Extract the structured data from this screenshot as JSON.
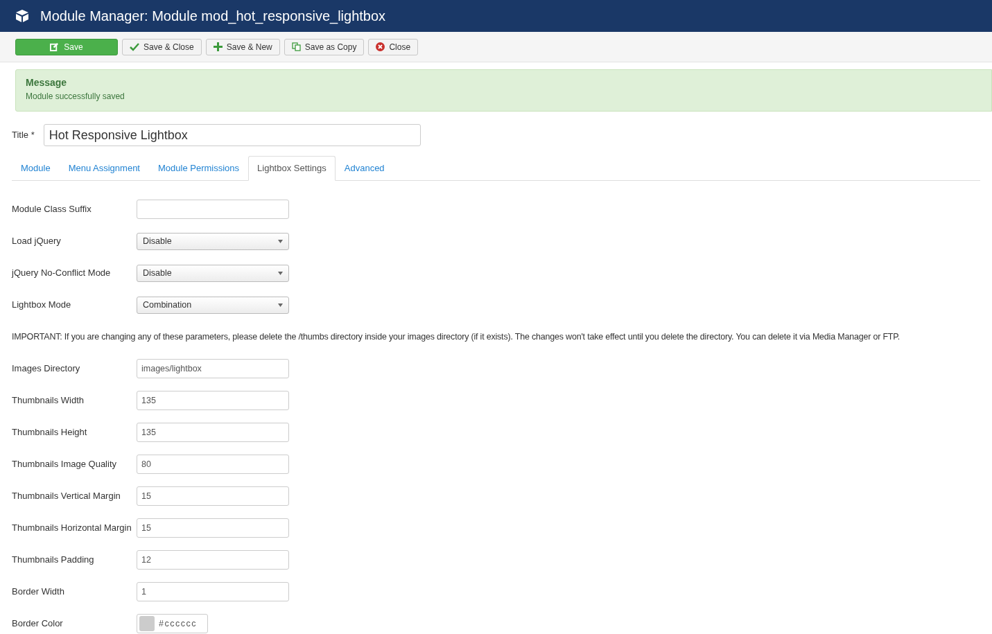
{
  "header": {
    "title": "Module Manager: Module mod_hot_responsive_lightbox"
  },
  "toolbar": [
    {
      "label": "Save",
      "kind": "save"
    },
    {
      "label": "Save & Close",
      "kind": "save-close"
    },
    {
      "label": "Save & New",
      "kind": "save-new"
    },
    {
      "label": "Save as Copy",
      "kind": "copy"
    },
    {
      "label": "Close",
      "kind": "close"
    }
  ],
  "message": {
    "heading": "Message",
    "text": "Module successfully saved"
  },
  "title_field": {
    "label": "Title *",
    "value": "Hot Responsive Lightbox"
  },
  "tabs": [
    {
      "label": "Module",
      "selected": false
    },
    {
      "label": "Menu Assignment",
      "selected": false
    },
    {
      "label": "Module Permissions",
      "selected": false
    },
    {
      "label": "Lightbox Settings",
      "selected": true
    },
    {
      "label": "Advanced",
      "selected": false
    }
  ],
  "fields": [
    {
      "kind": "text",
      "label": "Module Class Suffix"
    },
    {
      "kind": "select",
      "label": "Load jQuery",
      "value": "Disable"
    },
    {
      "kind": "select",
      "label": "jQuery No-Conflict Mode",
      "value": "Disable"
    },
    {
      "kind": "select",
      "label": "Lightbox Mode",
      "value": "Combination"
    },
    {
      "kind": "note",
      "text": "IMPORTANT: If you are changing any of these parameters, please delete the /thumbs directory inside your images directory (if it exists). The changes won't take effect until you delete the directory. You can delete it via Media Manager or FTP."
    },
    {
      "kind": "text",
      "label": "Images Directory",
      "value": "images/lightbox"
    },
    {
      "kind": "text",
      "label": "Thumbnails Width",
      "value": "135"
    },
    {
      "kind": "text",
      "label": "Thumbnails Height",
      "value": "135"
    },
    {
      "kind": "text",
      "label": "Thumbnails Image Quality",
      "value": "80"
    },
    {
      "kind": "text",
      "label": "Thumbnails Vertical Margin",
      "value": "15"
    },
    {
      "kind": "text",
      "label": "Thumbnails Horizontal Margin",
      "value": "15"
    },
    {
      "kind": "text",
      "label": "Thumbnails Padding",
      "value": "12"
    },
    {
      "kind": "text",
      "label": "Border Width",
      "value": "1"
    },
    {
      "kind": "color",
      "label": "Border Color",
      "value": "#cccccc",
      "color": "#cccccc"
    }
  ]
}
